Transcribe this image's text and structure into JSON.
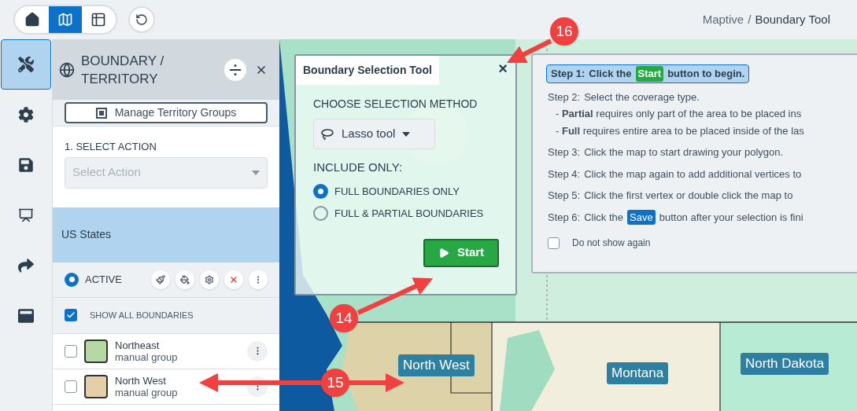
{
  "toolbar": {
    "views": [
      {
        "selected": false
      },
      {
        "selected": true
      },
      {
        "selected": false
      }
    ]
  },
  "breadcrumb": {
    "items": [
      {
        "label": "Maptive",
        "selected": false
      },
      {
        "label": "Boundary Tool",
        "selected": true
      }
    ],
    "separator": "/"
  },
  "rail": [
    {
      "selected": true
    },
    {
      "selected": false
    },
    {
      "selected": false
    },
    {
      "selected": false
    },
    {
      "selected": false
    },
    {
      "selected": false
    }
  ],
  "panel": {
    "title": "BOUNDARY / TERRITORY",
    "manage_button": "Manage Territory Groups",
    "action_label": "1. SELECT ACTION",
    "action_select": {
      "placeholder": "Select Action",
      "disabled": true
    },
    "layer": "US States",
    "active": {
      "label": "ACTIVE",
      "selected": true
    },
    "show_all": {
      "label": "SHOW ALL BOUNDARIES",
      "checked": true
    },
    "groups": [
      {
        "name": "Northeast",
        "type": "manual group",
        "checked": false,
        "color": "#b5d9a3"
      },
      {
        "name": "North West",
        "type": "manual group",
        "checked": false,
        "color": "#e3cfa8"
      }
    ]
  },
  "dialog": {
    "title": "Boundary Selection Tool",
    "close": "×",
    "method_label": "CHOOSE SELECTION METHOD",
    "method": "Lasso tool",
    "include_label": "INCLUDE ONLY:",
    "options": [
      {
        "label": "FULL BOUNDARIES ONLY",
        "selected": true
      },
      {
        "label": "FULL & PARTIAL BOUNDARIES",
        "selected": false
      }
    ],
    "start": "Start"
  },
  "instructions": {
    "steps": [
      {
        "label": "Step 1:",
        "before": "Click the",
        "badge": {
          "text": "Start",
          "kind": "start"
        },
        "after": "button to begin.",
        "highlighted": true
      },
      {
        "label": "Step 2:",
        "before": "Select the coverage type.",
        "highlighted": false,
        "notes": [
          "- **Partial** requires only part of the area to be placed ins",
          "- **Full** requires entire area to be placed inside of the las"
        ]
      },
      {
        "label": "Step 3:",
        "before": "Click the map to start drawing your polygon.",
        "highlighted": false
      },
      {
        "label": "Step 4:",
        "before": "Click the map again to add additional vertices to",
        "highlighted": false
      },
      {
        "label": "Step 5:",
        "before": "Click the first vertex or double click the map to",
        "highlighted": false
      },
      {
        "label": "Step 6:",
        "before": "Click the",
        "badge": {
          "text": "Save",
          "kind": "save"
        },
        "after": "button after your selection is fini",
        "highlighted": false
      }
    ],
    "dont_show": {
      "label": "Do not show again",
      "checked": false
    }
  },
  "map_labels": [
    {
      "text": "North West"
    },
    {
      "text": "Montana"
    },
    {
      "text": "North Dakota"
    }
  ],
  "annotations": [
    {
      "number": "16"
    },
    {
      "number": "14"
    },
    {
      "number": "15"
    }
  ]
}
